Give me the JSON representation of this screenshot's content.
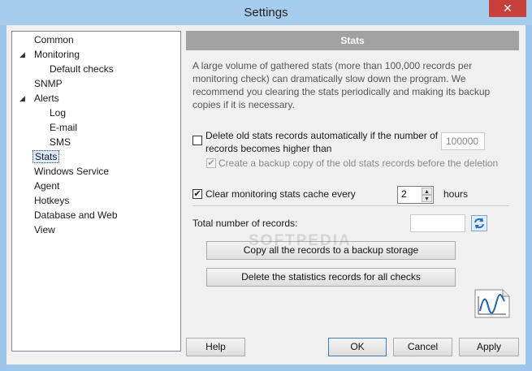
{
  "window": {
    "title": "Settings",
    "close_glyph": "✕"
  },
  "tree": {
    "items": [
      {
        "label": "Common",
        "level": 0,
        "expander": ""
      },
      {
        "label": "Monitoring",
        "level": 0,
        "expander": "minus"
      },
      {
        "label": "Default checks",
        "level": 1,
        "expander": ""
      },
      {
        "label": "SNMP",
        "level": 0,
        "expander": ""
      },
      {
        "label": "Alerts",
        "level": 0,
        "expander": "minus"
      },
      {
        "label": "Log",
        "level": 1,
        "expander": ""
      },
      {
        "label": "E-mail",
        "level": 1,
        "expander": ""
      },
      {
        "label": "SMS",
        "level": 1,
        "expander": ""
      },
      {
        "label": "Stats",
        "level": 0,
        "expander": "",
        "selected": true
      },
      {
        "label": "Windows Service",
        "level": 0,
        "expander": ""
      },
      {
        "label": "Agent",
        "level": 0,
        "expander": ""
      },
      {
        "label": "Hotkeys",
        "level": 0,
        "expander": ""
      },
      {
        "label": "Database and Web",
        "level": 0,
        "expander": ""
      },
      {
        "label": "View",
        "level": 0,
        "expander": ""
      }
    ]
  },
  "stats": {
    "header": "Stats",
    "description": "A large volume of gathered stats (more than 100,000 records per monitoring check) can dramatically slow down the program. We recommend you clearing the stats periodically and making its backup copies if it is necessary.",
    "delete_old": {
      "label": "Delete old stats records automatically if the number of records becomes higher than",
      "checked": false,
      "value": "100000"
    },
    "backup_copy": {
      "label": "Create a backup copy of the old stats records before the deletion",
      "checked": true,
      "disabled": true
    },
    "clear_cache": {
      "label": "Clear monitoring stats cache every",
      "checked": true,
      "value": "2",
      "unit": "hours"
    },
    "total_records": {
      "label": "Total number of records:",
      "value": ""
    },
    "copy_button": "Copy all the records to a backup storage",
    "delete_button": "Delete the statistics records for all checks",
    "refresh_icon": "refresh-icon",
    "chart_icon": "stats-chart-icon"
  },
  "footer": {
    "help": "Help",
    "ok": "OK",
    "cancel": "Cancel",
    "apply": "Apply"
  },
  "watermark": "SOFTPEDIA",
  "colors": {
    "titlebar": "#a7cdee",
    "header": "#a2a2a2",
    "close": "#c7403a"
  }
}
